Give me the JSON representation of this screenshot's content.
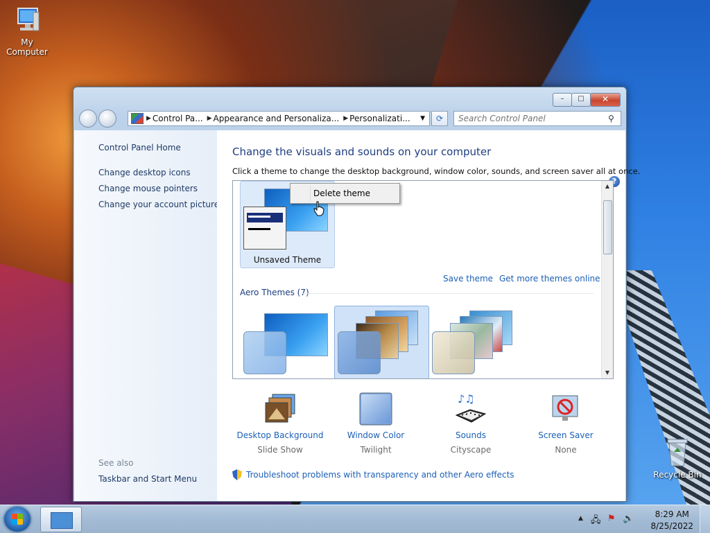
{
  "desktop": {
    "icons": [
      {
        "label": "My Computer"
      },
      {
        "label": "Recycle Bin"
      }
    ]
  },
  "window": {
    "controls": {
      "minimize": "–",
      "maximize": "□",
      "close": "✕"
    },
    "breadcrumbs": [
      "Control Pa...",
      "Appearance and Personaliza...",
      "Personalizati..."
    ],
    "search_placeholder": "Search Control Panel",
    "help": "?"
  },
  "sidebar": {
    "home": "Control Panel Home",
    "links": [
      "Change desktop icons",
      "Change mouse pointers",
      "Change your account picture"
    ],
    "see_also_label": "See also",
    "see_also_links": [
      "Taskbar and Start Menu"
    ]
  },
  "main": {
    "heading": "Change the visuals and sounds on your computer",
    "subheading": "Click a theme to change the desktop background, window color, sounds, and screen saver all at once.",
    "unsaved_theme_label": "Unsaved Theme",
    "save_theme": "Save theme",
    "get_more_themes": "Get more themes online",
    "aero_section": "Aero Themes (7)",
    "context_menu": {
      "item": "Delete theme"
    },
    "bottom_items": [
      {
        "title": "Desktop Background",
        "value": "Slide Show",
        "icon": "desktop-background-icon"
      },
      {
        "title": "Window Color",
        "value": "Twilight",
        "icon": "window-color-icon"
      },
      {
        "title": "Sounds",
        "value": "Cityscape",
        "icon": "sounds-icon"
      },
      {
        "title": "Screen Saver",
        "value": "None",
        "icon": "screen-saver-icon"
      }
    ],
    "troubleshoot_link": "Troubleshoot problems with transparency and other Aero effects"
  },
  "taskbar": {
    "time": "8:29 AM",
    "date": "8/25/2022"
  },
  "colors": {
    "link": "#1b5fb6",
    "heading": "#1e3d80",
    "selection": "#ddeafa"
  }
}
